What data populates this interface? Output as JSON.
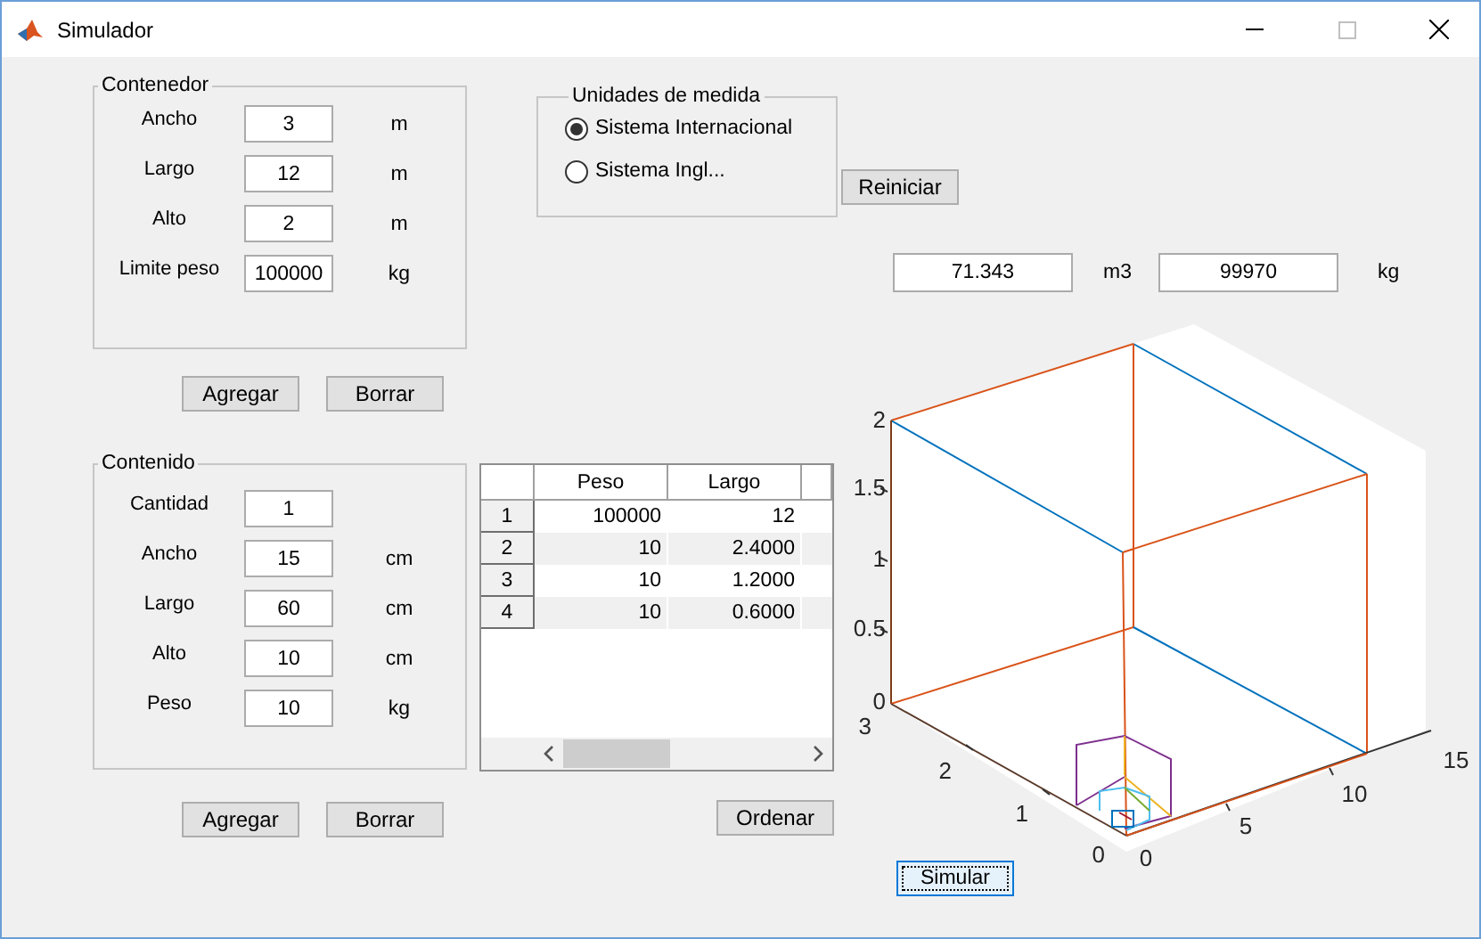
{
  "window": {
    "title": "Simulador"
  },
  "container_panel": {
    "title": "Contenedor",
    "fields": [
      {
        "label": "Ancho",
        "value": "3",
        "unit": "m"
      },
      {
        "label": "Largo",
        "value": "12",
        "unit": "m"
      },
      {
        "label": "Alto",
        "value": "2",
        "unit": "m"
      },
      {
        "label": "Limite peso",
        "value": "100000",
        "unit": "kg"
      }
    ],
    "buttons": [
      "Agregar",
      "Borrar"
    ]
  },
  "units_panel": {
    "title": "Unidades de medida",
    "options": [
      {
        "label": "Sistema Internacional",
        "selected": true
      },
      {
        "label": "Sistema Ingl...",
        "selected": false
      }
    ]
  },
  "reset_button": "Reiniciar",
  "results": [
    {
      "value": "71.343",
      "unit": "m3"
    },
    {
      "value": "99970",
      "unit": "kg"
    }
  ],
  "content_panel": {
    "title": "Contenido",
    "fields": [
      {
        "label": "Cantidad",
        "value": "1"
      },
      {
        "label": "Ancho",
        "value": "15",
        "unit": "cm"
      },
      {
        "label": "Largo",
        "value": "60",
        "unit": "cm"
      },
      {
        "label": "Alto",
        "value": "10",
        "unit": "cm"
      },
      {
        "label": "Peso",
        "value": "10",
        "unit": "kg"
      }
    ],
    "buttons": [
      "Agregar",
      "Borrar"
    ]
  },
  "table": {
    "columns": [
      "Peso",
      "Largo"
    ],
    "rows": [
      {
        "index": "1",
        "cells": [
          "100000",
          "12"
        ]
      },
      {
        "index": "2",
        "cells": [
          "10",
          "2.4000"
        ]
      },
      {
        "index": "3",
        "cells": [
          "10",
          "1.2000"
        ]
      },
      {
        "index": "4",
        "cells": [
          "10",
          "0.6000"
        ]
      }
    ]
  },
  "sort_button": "Ordenar",
  "simulate_button": "Simular",
  "plot": {
    "z_ticks": [
      "2",
      "1.5",
      "1",
      "0.5",
      "0"
    ],
    "y_ticks": [
      "3",
      "2",
      "1",
      "0"
    ],
    "x_ticks": [
      "0",
      "5",
      "10",
      "15"
    ]
  }
}
